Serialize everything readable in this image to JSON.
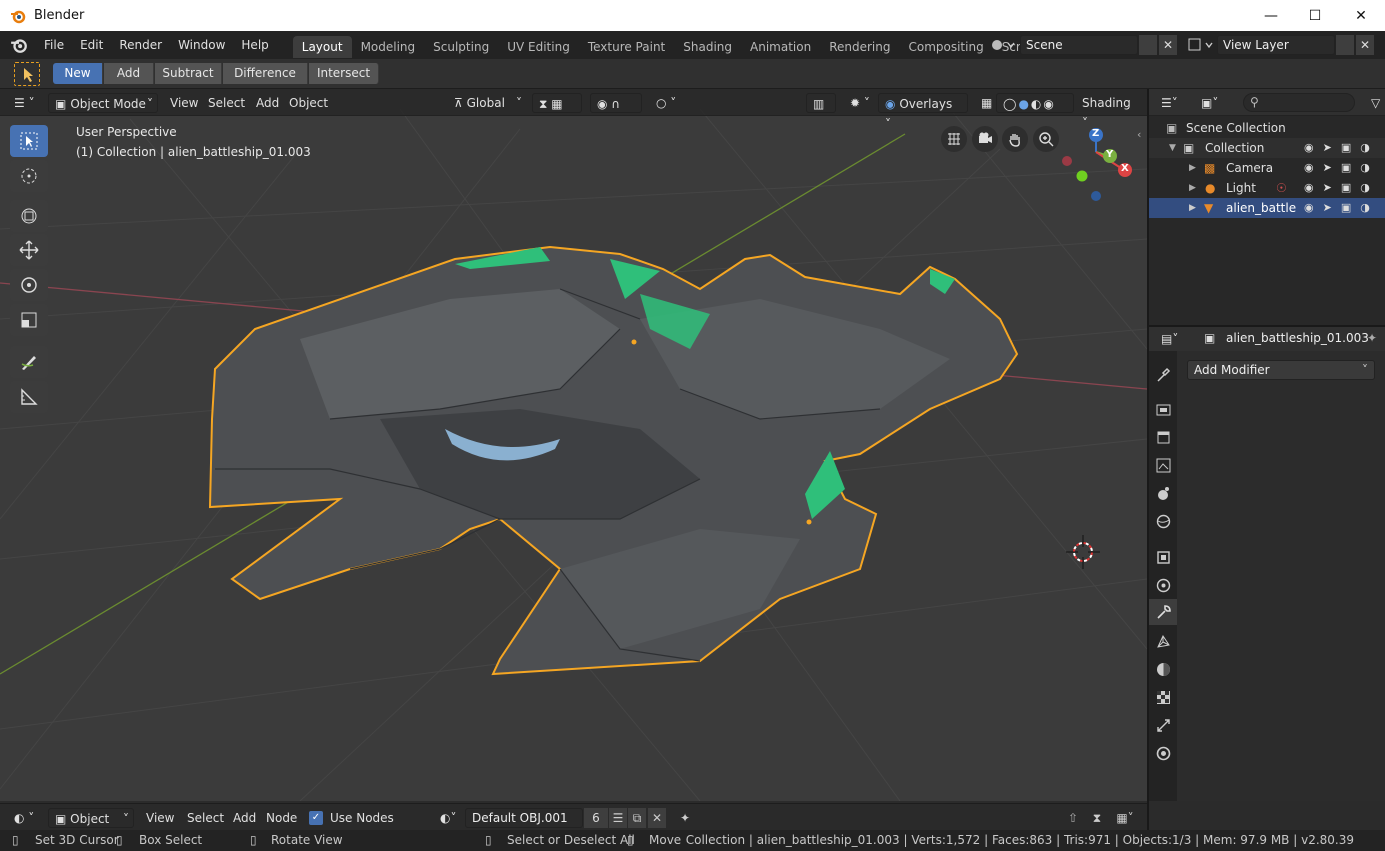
{
  "app_title": "Blender",
  "menu": [
    "File",
    "Edit",
    "Render",
    "Window",
    "Help"
  ],
  "workspaces": [
    "Layout",
    "Modeling",
    "Sculpting",
    "UV Editing",
    "Texture Paint",
    "Shading",
    "Animation",
    "Rendering",
    "Compositing",
    "Scripting"
  ],
  "scene_name": "Scene",
  "view_layer": "View Layer",
  "mode_buttons": [
    "New",
    "Add",
    "Subtract",
    "Difference",
    "Intersect"
  ],
  "viewport_header": {
    "mode": "Object Mode",
    "menus": [
      "View",
      "Select",
      "Add",
      "Object"
    ],
    "orientation": "Global",
    "overlays": "Overlays",
    "shading": "Shading"
  },
  "viewport_overlay": {
    "line1": "User Perspective",
    "line2": "(1) Collection | alien_battleship_01.003"
  },
  "gizmo_axes": [
    "X",
    "Y",
    "Z"
  ],
  "outliner": {
    "root": "Scene Collection",
    "collection": "Collection",
    "items": [
      "Camera",
      "Light",
      "alien_battlesh"
    ]
  },
  "properties": {
    "object_name": "alien_battleship_01.003",
    "add_modifier": "Add Modifier"
  },
  "bottom_header": {
    "type": "Object",
    "menus": [
      "View",
      "Select",
      "Add",
      "Node"
    ],
    "use_nodes": "Use Nodes",
    "material": "Default OBJ.001",
    "users": "6"
  },
  "statusbar": {
    "set_cursor": "Set 3D Cursor",
    "box_select": "Box Select",
    "rotate_view": "Rotate View",
    "select_deselect": "Select or Deselect All",
    "move": "Move",
    "info": "Collection | alien_battleship_01.003 | Verts:1,572 | Faces:863 | Tris:971 | Objects:1/3 | Mem: 97.9 MB | v2.80.39"
  },
  "colors": {
    "accent": "#4772b3",
    "selection_outline": "#f5a623",
    "ship_glow": "#2fbf7a"
  }
}
